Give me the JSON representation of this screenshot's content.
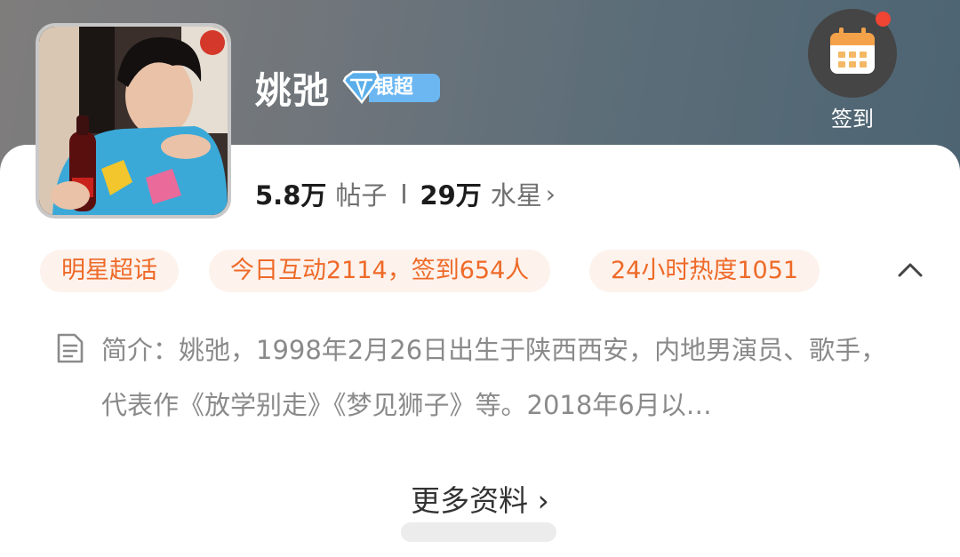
{
  "profile": {
    "name": "姚弛",
    "badge_label": "银超",
    "badge_level": "1"
  },
  "checkin": {
    "label": "签到"
  },
  "stats": {
    "posts_value": "5.8万",
    "posts_label": "帖子",
    "fans_value": "29万",
    "fans_label": "水星"
  },
  "tags": [
    "明星超话",
    "今日互动2114，签到654人",
    "24小时热度1051"
  ],
  "intro": {
    "text": "简介：姚弛，1998年2月26日出生于陕西西安，内地男演员、歌手，代表作《放学别走》《梦见狮子》等。2018年6月以…"
  },
  "more_link": "更多资料 ›",
  "colors": {
    "tag_text": "#ee6a28",
    "tag_bg": "#fdf2ec",
    "badge_blue": "#6cb7f2",
    "notification_dot": "#f04434"
  },
  "icons": [
    "calendar-icon",
    "diamond-icon",
    "chevron-right-icon",
    "chevron-up-icon",
    "document-icon"
  ]
}
